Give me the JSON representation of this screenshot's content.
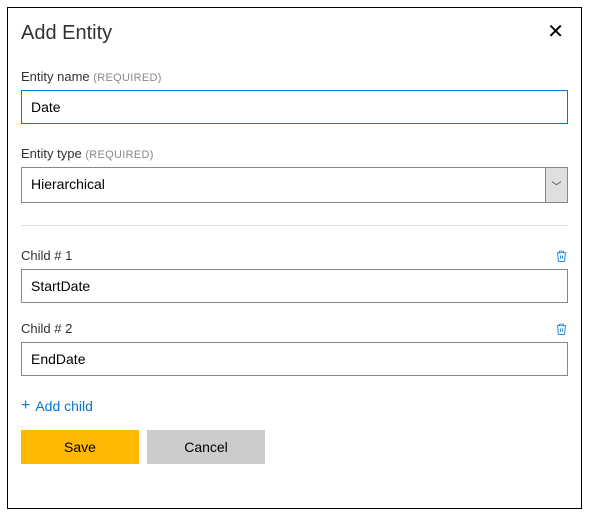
{
  "title": "Add Entity",
  "entity_name": {
    "label": "Entity name",
    "required_tag": "(REQUIRED)",
    "value": "Date"
  },
  "entity_type": {
    "label": "Entity type",
    "required_tag": "(REQUIRED)",
    "value": "Hierarchical"
  },
  "children": [
    {
      "label": "Child # 1",
      "value": "StartDate"
    },
    {
      "label": "Child # 2",
      "value": "EndDate"
    }
  ],
  "add_child_label": "Add child",
  "buttons": {
    "save": "Save",
    "cancel": "Cancel"
  }
}
